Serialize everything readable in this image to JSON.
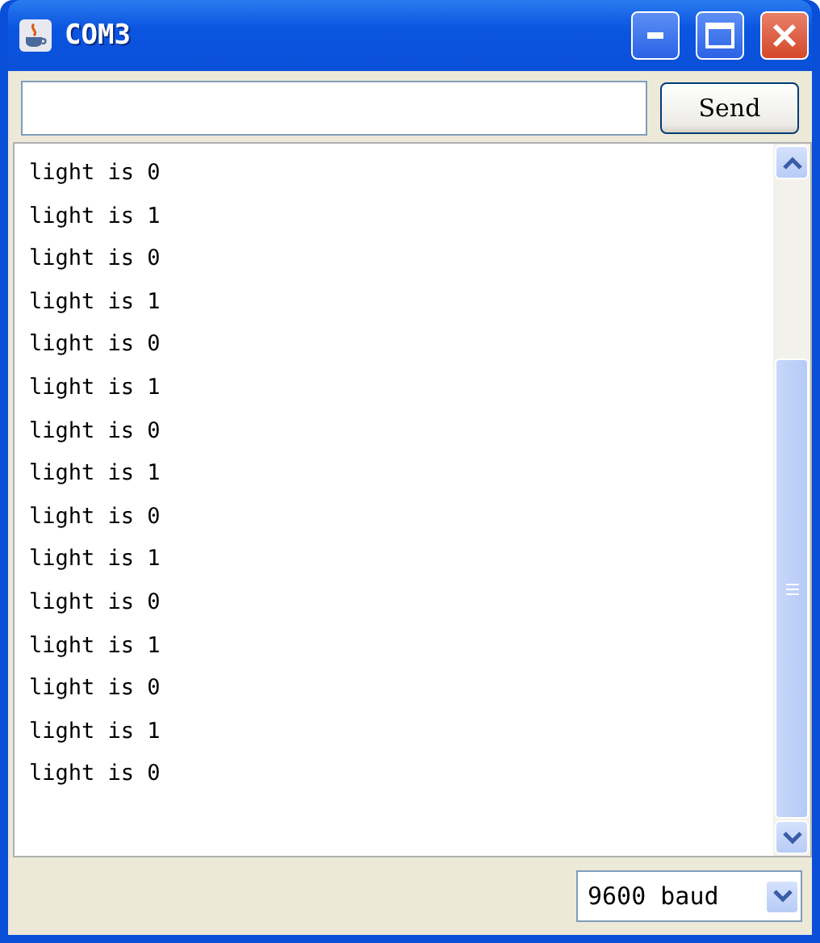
{
  "window": {
    "title": "COM3"
  },
  "send_button": "Send",
  "output_lines": [
    "light is 0",
    "light is 1",
    "light is 0",
    "light is 1",
    "light is 0",
    "light is 1",
    "light is 0",
    "light is 1",
    "light is 0",
    "light is 1",
    "light is 0",
    "light is 1",
    "light is 0",
    "light is 1",
    "light is 0"
  ],
  "baud": {
    "value": "9600 baud"
  }
}
